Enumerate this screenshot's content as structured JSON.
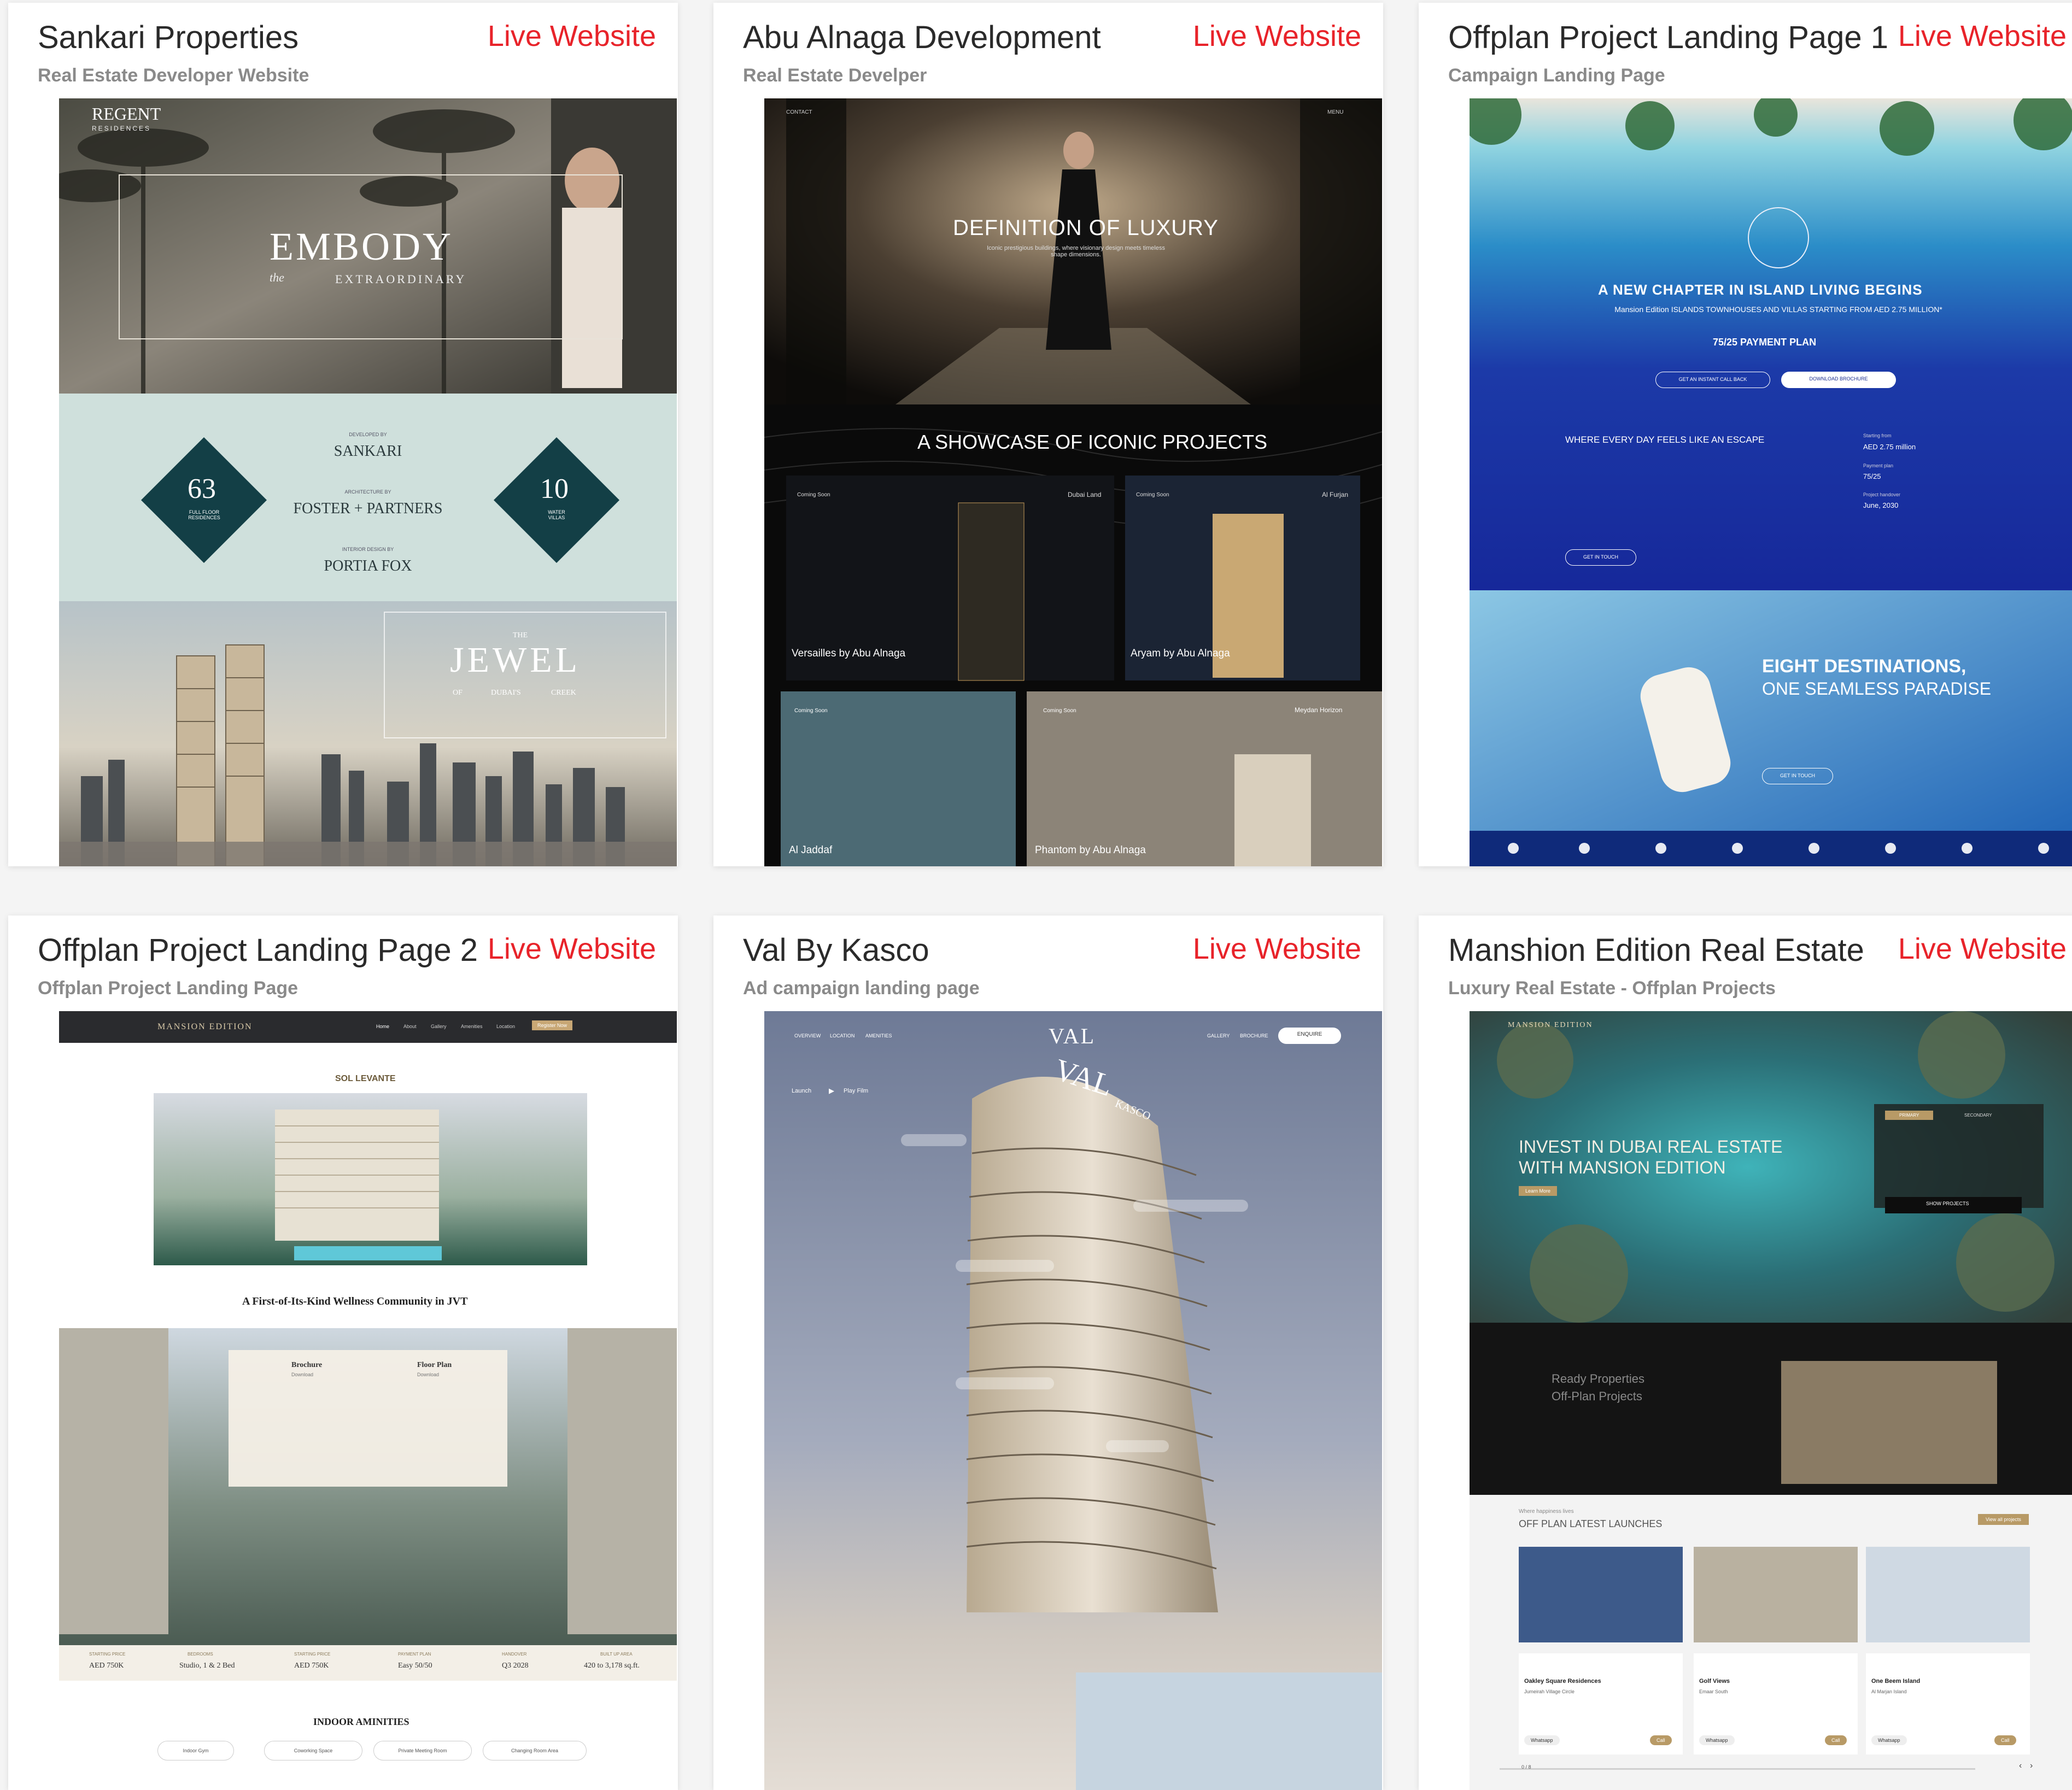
{
  "live_label": "Live Website",
  "cards": [
    {
      "title": "Sankari Properties",
      "subtitle": "Real Estate Developer Website",
      "shot": {
        "brand": "REGENT",
        "brand_sub": "RESIDENCES",
        "hero": "EMBODY",
        "hero_the": "the",
        "hero_sub": "EXTRAORDINARY",
        "stat1_value": "63",
        "stat1_label": "FULL FLOOR RESIDENCES",
        "stat2_value": "10",
        "stat2_label": "WATER VILLAS",
        "dev_by_label": "DEVELOPED BY",
        "dev_by": "SANKARI",
        "arch_by_label": "ARCHITECTURE BY",
        "arch_by": "FOSTER + PARTNERS",
        "interior_label": "INTERIOR DESIGN BY",
        "interior_by": "PORTIA FOX",
        "jewel_the": "THE",
        "jewel": "JEWEL",
        "jewel_of": "OF",
        "jewel_dubai": "DUBAI'S",
        "jewel_creek": "CREEK"
      }
    },
    {
      "title": "Abu Alnaga Development",
      "subtitle": "Real Estate Develper",
      "shot": {
        "contact": "CONTACT",
        "menu": "MENU",
        "hero": "DEFINITION OF LUXURY",
        "hero_sub": "Iconic prestigious buildings, where visionary design meets timeless shape dimensions.",
        "showcase": "A SHOWCASE OF ICONIC PROJECTS",
        "coming_soon": "Coming Soon",
        "p1_name": "Versailles by Abu Alnaga",
        "p1_loc": "Dubai Land",
        "p2_name": "Aryam by Abu Alnaga",
        "p2_loc": "Al Furjan",
        "p3_name": "Al Jaddaf",
        "p4_name": "Phantom by Abu Alnaga",
        "p4_loc": "Meydan Horizon"
      }
    },
    {
      "title": "Offplan Project Landing Page 1",
      "subtitle": "Campaign Landing Page",
      "shot": {
        "headline": "A NEW CHAPTER IN ISLAND LIVING BEGINS",
        "subline": "Mansion Edition ISLANDS TOWNHOUSES AND VILLAS STARTING FROM AED 2.75 MILLION*",
        "plan": "75/25 PAYMENT PLAN",
        "btn_call": "GET AN INSTANT CALL BACK",
        "btn_brochure": "DOWNLOAD BROCHURE",
        "escape": "WHERE EVERY DAY FEELS LIKE AN ESCAPE",
        "starting_label": "Starting from",
        "starting": "AED 2.75 million",
        "payment_label": "Payment plan",
        "payment": "75/25",
        "handover_label": "Project handover",
        "handover": "June, 2030",
        "touch": "GET IN TOUCH",
        "dest1": "EIGHT DESTINATIONS,",
        "dest2": "ONE SEAMLESS PARADISE",
        "enquire": "GET IN TOUCH"
      }
    },
    {
      "title": "Offplan Project Landing Page 2",
      "subtitle": "Offplan Project Landing Page",
      "shot": {
        "brand": "MANSION EDITION",
        "nav": [
          "Home",
          "About",
          "Gallery",
          "Amenities",
          "Location"
        ],
        "nav_cta": "Register Now",
        "project": "SOL LEVANTE",
        "tagline": "A First-of-Its-Kind Wellness Community in JVT",
        "brochure": "Brochure",
        "floor_plan": "Floor Plan",
        "download": "Download",
        "stats": [
          {
            "label": "STARTING PRICE",
            "value": "AED 750K"
          },
          {
            "label": "BEDROOMS",
            "value": "Studio, 1 & 2 Bed"
          },
          {
            "label": "STARTING PRICE",
            "value": "AED 750K"
          },
          {
            "label": "PAYMENT PLAN",
            "value": "Easy 50/50"
          },
          {
            "label": "HANDOVER",
            "value": "Q3 2028"
          },
          {
            "label": "BUILT UP AREA",
            "value": "420 to 3,178 sq.ft."
          }
        ],
        "amenities_title": "INDOOR AMINITIES",
        "amenities": [
          "Indoor Gym",
          "Coworking Space",
          "Private Meeting Room",
          "Changing Room Area"
        ]
      }
    },
    {
      "title": "Val By Kasco",
      "subtitle": "Ad campaign landing page",
      "shot": {
        "logo": "VAL",
        "nav": [
          "OVERVIEW",
          "LOCATION",
          "AMENITIES"
        ],
        "nav_right": [
          "GALLERY",
          "BROCHURE"
        ],
        "cta": "ENQUIRE",
        "launch": "Launch",
        "play": "Play Film",
        "tower": "VAL",
        "tower_sub": "KASCO"
      }
    },
    {
      "title": "Manshion Edition Real Estate",
      "subtitle": "Luxury Real Estate - Offplan Projects",
      "shot": {
        "brand": "MANSION EDITION",
        "hero1": "INVEST IN DUBAI REAL ESTATE",
        "hero2": "WITH MANSION EDITION",
        "hero_btn": "Learn More",
        "tab1": "PRIMARY",
        "tab2": "SECONDARY",
        "search_btn": "SHOW PROJECTS",
        "ready": "Ready Properties",
        "offplan": "Off-Plan Projects",
        "launch_pre": "Where happiness lives",
        "launch_title": "OFF PLAN LATEST LAUNCHES",
        "view_all": "View all projects",
        "listings": [
          {
            "name": "Oakley Square Residences",
            "loc": "Jumeirah Village Circle"
          },
          {
            "name": "Golf Views",
            "loc": "Emaar South"
          },
          {
            "name": "One Beem Island",
            "loc": "Al Marjan Island"
          }
        ],
        "whatsapp": "Whatsapp",
        "call": "Call",
        "pager": "0 / 8"
      }
    }
  ]
}
